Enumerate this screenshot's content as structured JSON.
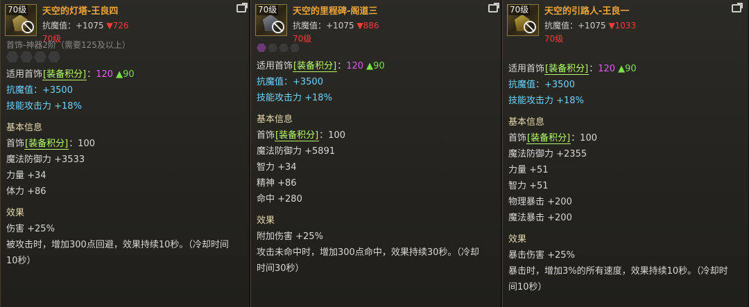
{
  "panels": [
    {
      "level_tag": "70级",
      "title": "天空的灯塔-王良四",
      "resist_label": "抗魔值：+1075",
      "resist_diff": "▼726",
      "level_text": "70级",
      "cut_line": "首饰-神器2阶（需要125及以上）",
      "lines": {
        "apply_prefix": "适用首饰",
        "equip_score_tag": "[装备积分]",
        "score_colon": "：",
        "score_value": "120",
        "score_diff": "▲90",
        "resist": "抗魔值：+3500",
        "skill_atk": "技能攻击力 +18%",
        "basic_info": "基本信息",
        "accessory": "首饰",
        "accessory_score": "：100",
        "stat1": "魔法防御力 +3533",
        "stat2": "力量 +34",
        "stat3": "体力 +86",
        "effect": "效果",
        "eff1": "伤害 +25%",
        "eff2": "被攻击时，增加300点回避，效果持续10秒。（冷却时间",
        "eff3": "10秒）"
      }
    },
    {
      "level_tag": "70级",
      "title": "天空的里程碑-阁道三",
      "resist_label": "抗魔值：+1075",
      "resist_diff": "▼886",
      "level_text": "70级",
      "lines": {
        "apply_prefix": "适用首饰",
        "equip_score_tag": "[装备积分]",
        "score_colon": "：",
        "score_value": "120",
        "score_diff": "▲90",
        "resist": "抗魔值：+3500",
        "skill_atk": "技能攻击力 +18%",
        "basic_info": "基本信息",
        "accessory": "首饰",
        "accessory_score": "：100",
        "stat1": "魔法防御力 +5891",
        "stat2": "智力 +34",
        "stat3": "精神 +86",
        "stat4": "命中 +280",
        "effect": "效果",
        "eff1": "附加伤害 +25%",
        "eff2": "攻击未命中时，增加300点命中，效果持续30秒。（冷却",
        "eff3": "时间30秒）"
      }
    },
    {
      "level_tag": "70级",
      "title": "天空的引路人-王良一",
      "resist_label": "抗魔值：+1075",
      "resist_diff": "▼1033",
      "level_text": "70级",
      "lines": {
        "apply_prefix": "适用首饰",
        "equip_score_tag": "[装备积分]",
        "score_colon": "：",
        "score_value": "120",
        "score_diff": "▲90",
        "resist": "抗魔值：+3500",
        "skill_atk": "技能攻击力 +18%",
        "basic_info": "基本信息",
        "accessory": "首饰",
        "accessory_score": "：100",
        "stat1": "魔法防御力 +2355",
        "stat2": "力量 +51",
        "stat3": "智力 +51",
        "stat4": "物理暴击 +200",
        "stat5": "魔法暴击 +200",
        "effect": "效果",
        "eff1": "暴击伤害 +25%",
        "eff2": "暴击时，增加3%的所有速度，效果持续10秒。（冷却时",
        "eff3": "间10秒）"
      }
    }
  ]
}
